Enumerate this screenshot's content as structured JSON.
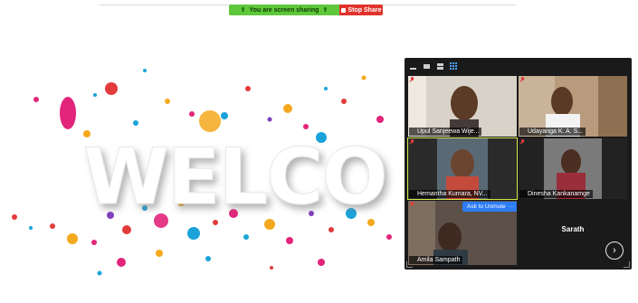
{
  "share_bar": {
    "status_text": "You are screen sharing",
    "stop_label": "Stop Share",
    "status_color": "#5ec83a",
    "stop_color": "#e0332c"
  },
  "background": {
    "headline": "WELCO"
  },
  "gallery": {
    "toolbar": [
      "minimize-icon",
      "speaker-view-icon",
      "film-strip-icon",
      "gallery-view-icon"
    ],
    "participants": [
      {
        "name": "Upul Sanjeewa Wije...",
        "muted": true
      },
      {
        "name": "Udayanga K. A. S...",
        "muted": true
      },
      {
        "name": "Hemantha Kumara, NV...",
        "muted": true,
        "active_speaker": true
      },
      {
        "name": "Dinesha Kankanamge",
        "muted": true
      },
      {
        "name": "Amila Sampath",
        "muted": true
      },
      {
        "name": "Sarath",
        "video": false
      }
    ],
    "ask_to_unmute_label": "Ask to Unmute",
    "more_label": "···",
    "next_page_icon": "chevron-right-icon",
    "accent_color": "#2d7cf6",
    "active_speaker_color": "#d7e84a"
  }
}
